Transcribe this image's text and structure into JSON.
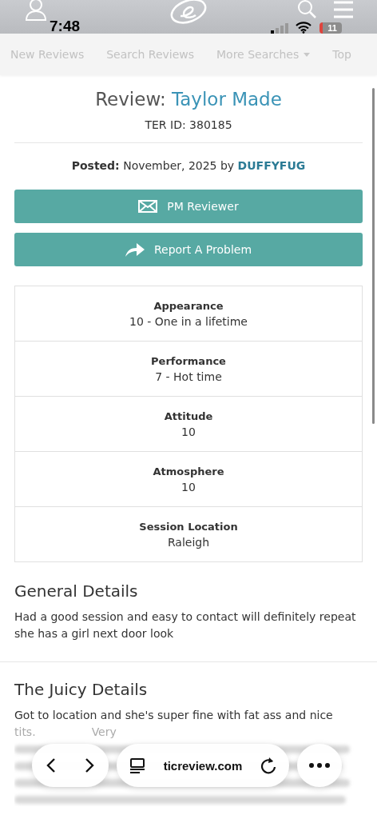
{
  "status_bar": {
    "time": "7:48",
    "battery": "11"
  },
  "nav": {
    "tabs": [
      {
        "label": "New Reviews",
        "has_menu": false
      },
      {
        "label": "Search Reviews",
        "has_menu": false
      },
      {
        "label": "More Searches",
        "has_menu": true
      },
      {
        "label": "Top",
        "has_menu": false
      }
    ]
  },
  "review": {
    "title_prefix": "Review:",
    "name": "Taylor Made",
    "ter_id": "TER ID: 380185",
    "posted": "**Posted:** November, 2025 by",
    "author": "DUFFYFUG"
  },
  "buttons": [
    {
      "kind": "mail",
      "label": "PM Reviewer"
    },
    {
      "kind": "share",
      "label": "Report A Problem"
    }
  ],
  "ratings": [
    {
      "label": "Appearance",
      "value": "10 - One in a lifetime"
    },
    {
      "label": "Performance",
      "value": "7 - Hot time"
    },
    {
      "label": "Attitude",
      "value": "10"
    },
    {
      "label": "Atmosphere",
      "value": "10"
    },
    {
      "label": "Session Location",
      "value": "Raleigh"
    }
  ],
  "general": {
    "heading": "General Details",
    "text": "Had a good session and easy to contact will definitely repeat she has a girl next door look"
  },
  "juicy": {
    "heading": "The Juicy Details",
    "line": "Got to location and she's super fine with fat ass and nice",
    "fragments": [
      "tits.",
      "Very"
    ]
  },
  "browser_bar": {
    "url": "ticreview.com"
  }
}
